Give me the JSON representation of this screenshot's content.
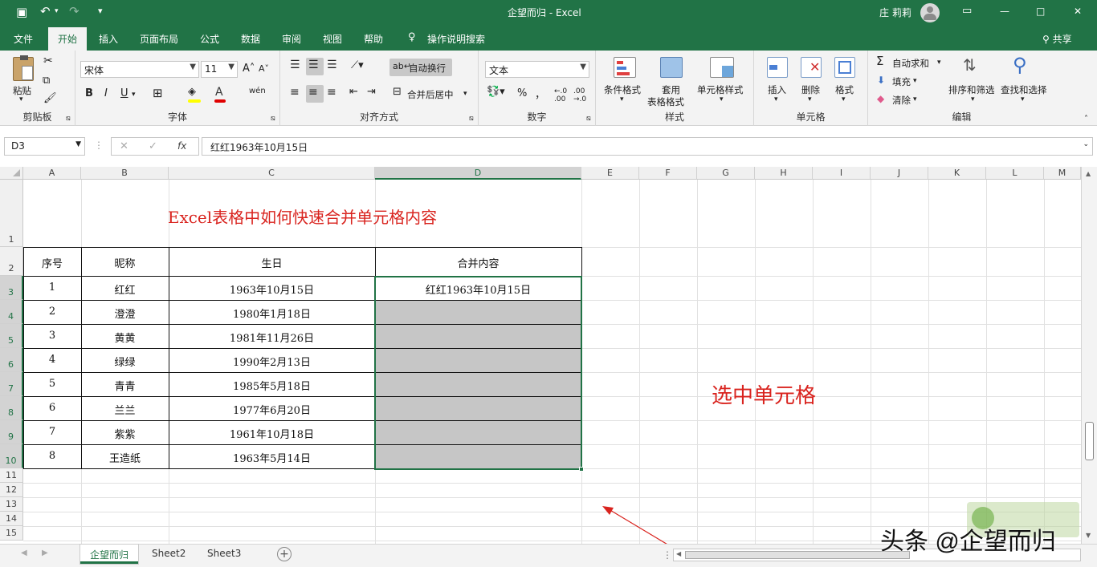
{
  "window": {
    "doc_title": "企望而归  -  Excel",
    "user": "庄 莉莉",
    "controls": [
      "—",
      "□",
      "✕"
    ]
  },
  "tabs": [
    "文件",
    "开始",
    "插入",
    "页面布局",
    "公式",
    "数据",
    "审阅",
    "视图",
    "帮助"
  ],
  "tell_me": "操作说明搜索",
  "share": "共享",
  "ribbon": {
    "clipboard": {
      "paste": "粘贴",
      "label": "剪贴板"
    },
    "font": {
      "name": "宋体",
      "size": "11",
      "label": "字体",
      "bold": "B",
      "italic": "I",
      "underline": "U",
      "grow": "A˄",
      "shrink": "A˅",
      "wen": "wén"
    },
    "align": {
      "wrap": "自动换行",
      "merge": "合并后居中",
      "label": "对齐方式"
    },
    "number": {
      "format": "文本",
      "label": "数字",
      "percent": "%",
      "comma": "，"
    },
    "styles": {
      "cond": "条件格式",
      "table1": "套用",
      "table2": "表格格式",
      "cell": "单元格样式",
      "label": "样式"
    },
    "cells": {
      "insert": "插入",
      "delete": "删除",
      "format": "格式",
      "label": "单元格"
    },
    "edit": {
      "autosum": "自动求和",
      "fill": "填充",
      "clear": "清除",
      "sort": "排序和筛选",
      "find": "查找和选择",
      "label": "编辑"
    }
  },
  "formula_bar": {
    "name_box": "D3",
    "fx": "fx",
    "content": "红红1963年10月15日"
  },
  "columns": [
    "A",
    "B",
    "C",
    "D",
    "E",
    "F",
    "G",
    "H",
    "I",
    "J",
    "K",
    "L",
    "M"
  ],
  "rows": [
    "1",
    "2",
    "3",
    "4",
    "5",
    "6",
    "7",
    "8",
    "9",
    "10",
    "11",
    "12",
    "13",
    "14",
    "15"
  ],
  "sheet": {
    "title": "Excel表格中如何快速合并单元格内容",
    "headers": [
      "序号",
      "昵称",
      "生日",
      "合并内容"
    ],
    "data": [
      [
        "1",
        "红红",
        "1963年10月15日",
        "红红1963年10月15日"
      ],
      [
        "2",
        "澄澄",
        "1980年1月18日",
        ""
      ],
      [
        "3",
        "黄黄",
        "1981年11月26日",
        ""
      ],
      [
        "4",
        "绿绿",
        "1990年2月13日",
        ""
      ],
      [
        "5",
        "青青",
        "1985年5月18日",
        ""
      ],
      [
        "6",
        "兰兰",
        "1977年6月20日",
        ""
      ],
      [
        "7",
        "紫紫",
        "1961年10月18日",
        ""
      ],
      [
        "8",
        "王造纸",
        "1963年5月14日",
        ""
      ]
    ],
    "annotation": "选中单元格"
  },
  "sheet_tabs": [
    "企望而归",
    "Sheet2",
    "Sheet3"
  ],
  "watermark": "头条 @企望而归",
  "colors": {
    "excel_green": "#217346",
    "annotation_red": "#d9231e",
    "selection_gray": "#c6c6c6"
  }
}
